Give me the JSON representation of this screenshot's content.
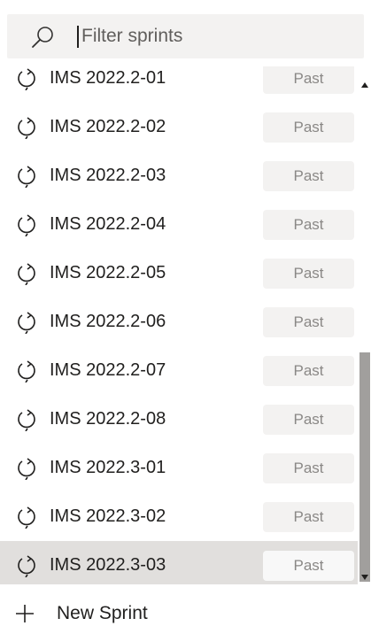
{
  "search": {
    "placeholder": "Filter sprints",
    "value": ""
  },
  "sprints": [
    {
      "name": "IMS 2022.2-01",
      "status": "Past"
    },
    {
      "name": "IMS 2022.2-02",
      "status": "Past"
    },
    {
      "name": "IMS 2022.2-03",
      "status": "Past"
    },
    {
      "name": "IMS 2022.2-04",
      "status": "Past"
    },
    {
      "name": "IMS 2022.2-05",
      "status": "Past"
    },
    {
      "name": "IMS 2022.2-06",
      "status": "Past"
    },
    {
      "name": "IMS 2022.2-07",
      "status": "Past"
    },
    {
      "name": "IMS 2022.2-08",
      "status": "Past"
    },
    {
      "name": "IMS 2022.3-01",
      "status": "Past"
    },
    {
      "name": "IMS 2022.3-02",
      "status": "Past"
    },
    {
      "name": "IMS 2022.3-03",
      "status": "Past",
      "selected": true
    }
  ],
  "footer": {
    "new_sprint_label": "New Sprint"
  },
  "icons": {
    "search": "search-icon",
    "iteration": "iteration-cycle-icon",
    "add": "plus-icon"
  },
  "colors": {
    "search_bg": "#f3f2f1",
    "badge_bg": "#f3f2f1",
    "badge_text": "#8a8886",
    "selected_row_bg": "#e1dfdd",
    "scroll_thumb": "#a19f9d"
  }
}
